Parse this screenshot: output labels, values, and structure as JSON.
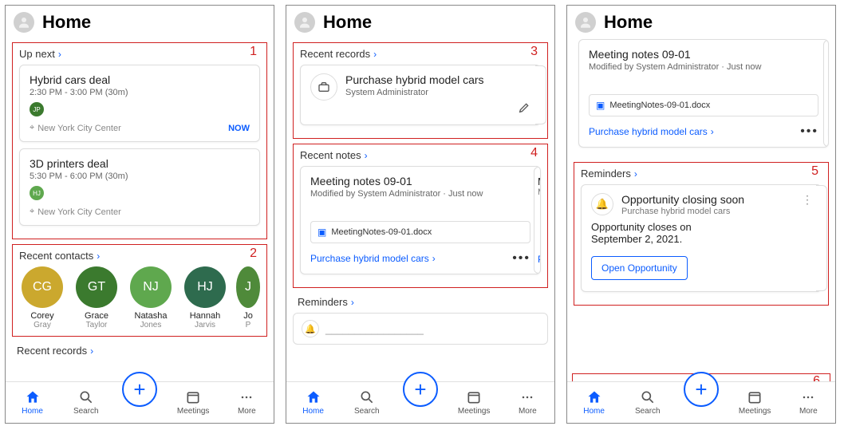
{
  "header": {
    "title": "Home"
  },
  "annotations": {
    "n1": "1",
    "n2": "2",
    "n3": "3",
    "n4": "4",
    "n5": "5",
    "n6": "6"
  },
  "sections": {
    "up_next": "Up next",
    "recent_contacts": "Recent contacts",
    "recent_records": "Recent records",
    "recent_notes": "Recent notes",
    "reminders": "Reminders"
  },
  "events": [
    {
      "title": "Hybrid cars deal",
      "time": "2:30 PM - 3:00 PM (30m)",
      "initials": "JP",
      "location": "New York City Center",
      "now": "NOW"
    },
    {
      "title": "3D printers deal",
      "time": "5:30 PM - 6:00 PM (30m)",
      "initials": "HJ",
      "location": "New York City Center"
    }
  ],
  "contacts": [
    {
      "initials": "CG",
      "first": "Corey",
      "last": "Gray",
      "color": "c-gold"
    },
    {
      "initials": "GT",
      "first": "Grace",
      "last": "Taylor",
      "color": "c-g1"
    },
    {
      "initials": "NJ",
      "first": "Natasha",
      "last": "Jones",
      "color": "c-g2"
    },
    {
      "initials": "HJ",
      "first": "Hannah",
      "last": "Jarvis",
      "color": "c-g3"
    },
    {
      "initials": "J",
      "first": "Jo",
      "last": "P",
      "color": "c-g4"
    }
  ],
  "record": {
    "title": "Purchase hybrid model cars",
    "sub": "System Administrator"
  },
  "note": {
    "title": "Meeting notes 09-01",
    "sub": "Modified by System Administrator · Just now",
    "file": "MeetingNotes-09-01.docx",
    "link": "Purchase hybrid model cars"
  },
  "note_peek": {
    "m": "M",
    "mo": "Mo",
    "pu": "Pu"
  },
  "reminder": {
    "title": "Opportunity closing soon",
    "sub": "Purchase hybrid model cars",
    "body": "Opportunity closes on\nSeptember 2, 2021.",
    "button": "Open Opportunity"
  },
  "nav": {
    "home": "Home",
    "search": "Search",
    "meetings": "Meetings",
    "more": "More"
  }
}
